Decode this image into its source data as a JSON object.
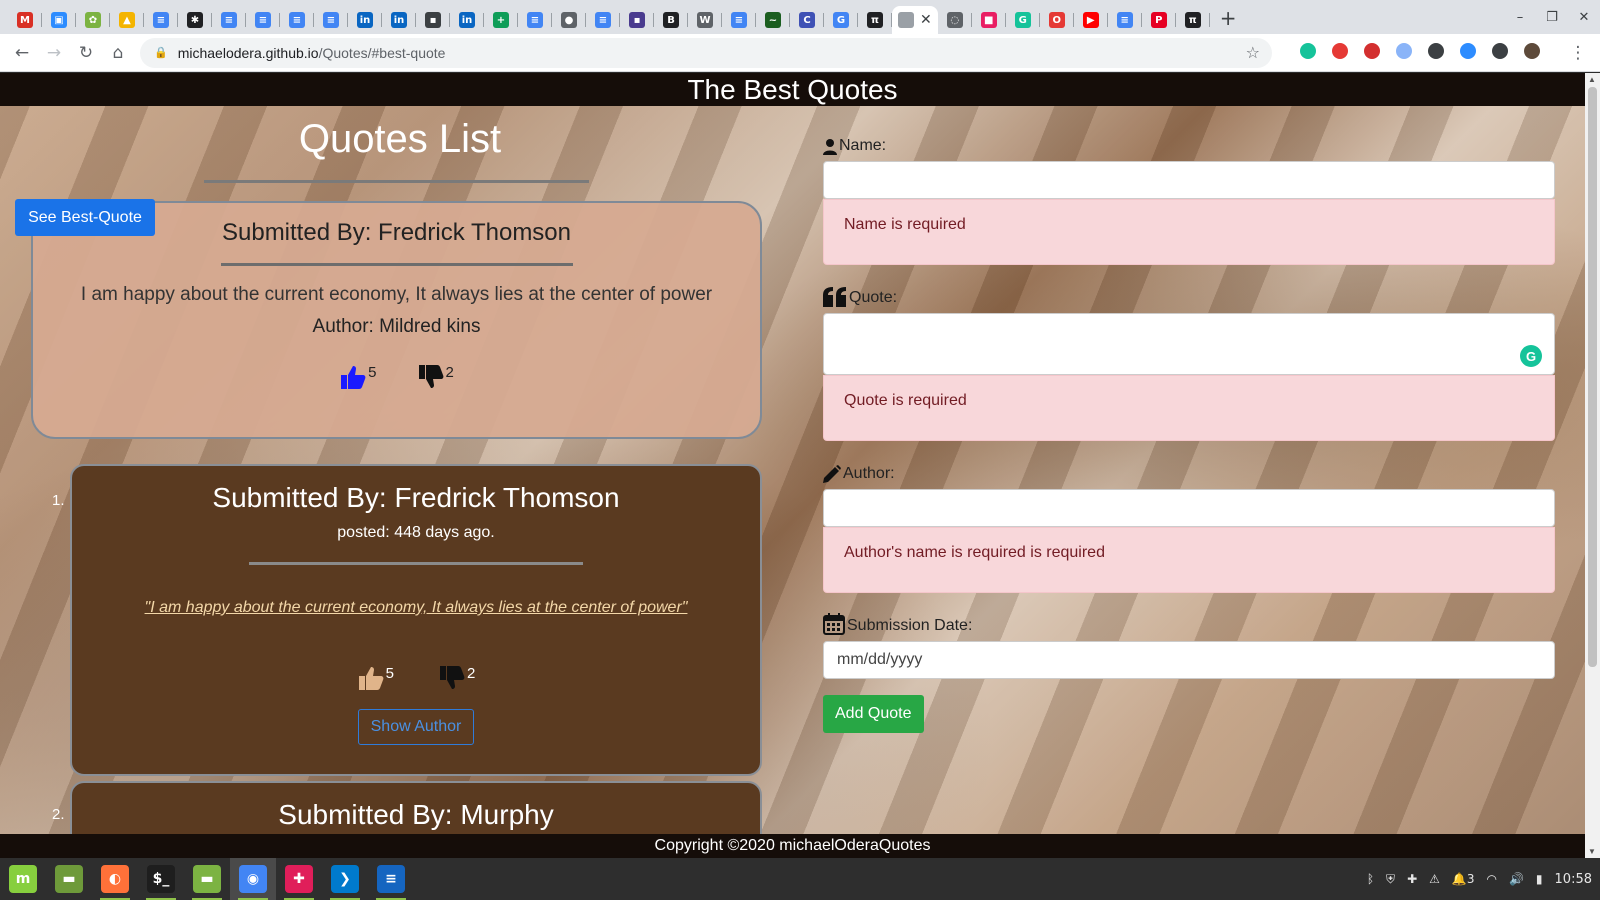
{
  "browser": {
    "tabs": [
      {
        "icon": "gmail-icon",
        "color": "#d93025",
        "glyph": "M"
      },
      {
        "icon": "zoom-icon",
        "color": "#2d8cff",
        "glyph": "▣"
      },
      {
        "icon": "plant-icon",
        "color": "#7cb342",
        "glyph": "✿"
      },
      {
        "icon": "google-drive-icon",
        "color": "#f4b400",
        "glyph": "▲"
      },
      {
        "icon": "google-docs-icon",
        "color": "#4285f4",
        "glyph": "≡"
      },
      {
        "icon": "translate-icon",
        "color": "#202124",
        "glyph": "✱"
      },
      {
        "icon": "google-docs-icon",
        "color": "#4285f4",
        "glyph": "≡"
      },
      {
        "icon": "google-docs-icon",
        "color": "#4285f4",
        "glyph": "≡"
      },
      {
        "icon": "google-docs-icon",
        "color": "#4285f4",
        "glyph": "≡"
      },
      {
        "icon": "google-docs-icon",
        "color": "#4285f4",
        "glyph": "≡"
      },
      {
        "icon": "linkedin-icon",
        "color": "#0a66c2",
        "glyph": "in"
      },
      {
        "icon": "linkedin-icon",
        "color": "#0a66c2",
        "glyph": "in"
      },
      {
        "icon": "briefcase-icon",
        "color": "#3c4043",
        "glyph": "▪"
      },
      {
        "icon": "linkedin-icon",
        "color": "#0a66c2",
        "glyph": "in"
      },
      {
        "icon": "google-sheets-icon",
        "color": "#0f9d58",
        "glyph": "+"
      },
      {
        "icon": "google-docs-icon",
        "color": "#4285f4",
        "glyph": "≡"
      },
      {
        "icon": "globe-icon",
        "color": "#5f6368",
        "glyph": "●"
      },
      {
        "icon": "google-docs-icon",
        "color": "#4285f4",
        "glyph": "≡"
      },
      {
        "icon": "site-icon",
        "color": "#4a3b8f",
        "glyph": "▪"
      },
      {
        "icon": "bold-b-icon",
        "color": "#202124",
        "glyph": "B"
      },
      {
        "icon": "wordpress-icon",
        "color": "#5f6368",
        "glyph": "W"
      },
      {
        "icon": "google-docs-icon",
        "color": "#4285f4",
        "glyph": "≡"
      },
      {
        "icon": "bird-icon",
        "color": "#1b5e20",
        "glyph": "~"
      },
      {
        "icon": "circle-c-icon",
        "color": "#3f51b5",
        "glyph": "C"
      },
      {
        "icon": "google-icon",
        "color": "#4285f4",
        "glyph": "G"
      },
      {
        "icon": "pi-icon",
        "color": "#202124",
        "glyph": "π"
      },
      {
        "icon": "loading-icon",
        "color": "#5f6368",
        "glyph": "◌"
      },
      {
        "icon": "colorful-grid-icon",
        "color": "#e91e63",
        "glyph": "■"
      },
      {
        "icon": "grammarly-icon",
        "color": "#15c39a",
        "glyph": "G"
      },
      {
        "icon": "opera-icon",
        "color": "#e53935",
        "glyph": "O"
      },
      {
        "icon": "youtube-icon",
        "color": "#ff0000",
        "glyph": "▶"
      },
      {
        "icon": "google-docs-icon",
        "color": "#4285f4",
        "glyph": "≡"
      },
      {
        "icon": "pinterest-icon",
        "color": "#e60023",
        "glyph": "P"
      },
      {
        "icon": "pi-icon",
        "color": "#202124",
        "glyph": "π"
      }
    ],
    "new_tab": "+",
    "url_host": "michaelodera.github.io",
    "url_path": "/Quotes/#best-quote",
    "extensions": [
      {
        "icon": "grammarly-ext-icon",
        "color": "#15c39a"
      },
      {
        "icon": "red-ext-icon",
        "color": "#e53935"
      },
      {
        "icon": "adblock-ext-icon",
        "color": "#d32f2f"
      },
      {
        "icon": "feather-ext-icon",
        "color": "#8ab4f8"
      },
      {
        "icon": "wave-ext-icon",
        "color": "#3c4043"
      },
      {
        "icon": "zoom-ext-icon",
        "color": "#2d8cff"
      },
      {
        "icon": "cube-ext-icon",
        "color": "#3c4043"
      },
      {
        "icon": "profile-avatar",
        "color": "#5d4a3a"
      }
    ]
  },
  "page": {
    "header_title": "The Best Quotes",
    "list_title": "Quotes List",
    "best_quote_button": "See Best-Quote",
    "best_quote": {
      "submitted_by": "Submitted By: Fredrick Thomson",
      "quote": "I am happy about the current economy, It always lies at the center of power",
      "author": "Author: Mildred kins",
      "upvotes": "5",
      "downvotes": "2"
    },
    "quotes": [
      {
        "number": "1.",
        "submitted_by": "Submitted By: Fredrick Thomson",
        "posted": "posted: 448 days ago.",
        "quote": "\"I am happy about the current economy, It always lies at the center of power\"",
        "upvotes": "5",
        "downvotes": "2",
        "show_author_label": "Show Author"
      },
      {
        "number": "2.",
        "submitted_by": "Submitted By: Murphy"
      }
    ],
    "form": {
      "name_label": "Name:",
      "name_error": "Name is required",
      "quote_label": "Quote:",
      "quote_error": "Quote is required",
      "author_label": "Author:",
      "author_error": "Author's name is required is required",
      "date_label": "Submission Date:",
      "date_placeholder": "mm/dd/yyyy",
      "submit_label": "Add Quote"
    },
    "footer": "Copyright ©2020 michaelOderaQuotes"
  },
  "taskbar": {
    "apps": [
      {
        "icon": "linux-mint-menu-icon",
        "color": "#87cf3e",
        "glyph": "m"
      },
      {
        "icon": "show-desktop-icon",
        "color": "#6e9a3a",
        "glyph": "▬"
      },
      {
        "icon": "firefox-icon",
        "color": "#ff7139",
        "glyph": "◐"
      },
      {
        "icon": "terminal-icon",
        "color": "#1e1e1e",
        "glyph": "$_"
      },
      {
        "icon": "files-icon",
        "color": "#7cb342",
        "glyph": "▬"
      },
      {
        "icon": "chrome-icon",
        "color": "#4285f4",
        "glyph": "◉"
      },
      {
        "icon": "slack-icon",
        "color": "#e01e5a",
        "glyph": "✚"
      },
      {
        "icon": "vscode-icon",
        "color": "#007acc",
        "glyph": "❯"
      },
      {
        "icon": "text-editor-icon",
        "color": "#1565c0",
        "glyph": "≡"
      }
    ],
    "tray": {
      "notification_count": "3",
      "clock": "10:58"
    }
  }
}
